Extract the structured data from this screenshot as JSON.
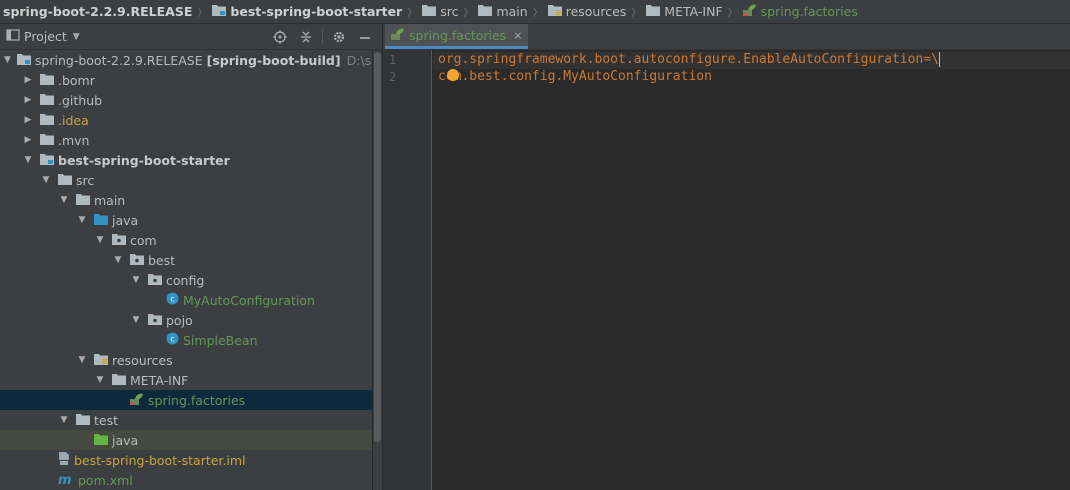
{
  "breadcrumb": [
    {
      "label": "spring-boot-2.2.9.RELEASE",
      "style": "bold",
      "icon": "module-folder-icon"
    },
    {
      "label": "best-spring-boot-starter",
      "style": "bold",
      "icon": "module-folder-icon"
    },
    {
      "label": "src",
      "style": "normal",
      "icon": "folder-icon"
    },
    {
      "label": "main",
      "style": "normal",
      "icon": "folder-icon"
    },
    {
      "label": "resources",
      "style": "normal",
      "icon": "resources-folder-icon"
    },
    {
      "label": "META-INF",
      "style": "normal",
      "icon": "folder-icon"
    },
    {
      "label": "spring.factories",
      "style": "green",
      "icon": "spring-leaf-icon"
    }
  ],
  "project_panel": {
    "title": "Project",
    "toolbar": [
      "locate-icon",
      "collapse-all-icon",
      "gear-icon",
      "hide-icon"
    ]
  },
  "tree": [
    {
      "label": "spring-boot-2.2.9.RELEASE",
      "extra_bold": "[spring-boot-build]",
      "path": "D:\\source\\",
      "arrow": "open",
      "icon": "module-folder-icon",
      "style": "normal"
    },
    {
      "label": ".bomr",
      "arrow": "closed",
      "icon": "folder-icon",
      "style": "normal"
    },
    {
      "label": ".github",
      "arrow": "closed",
      "icon": "folder-icon",
      "style": "normal"
    },
    {
      "label": ".idea",
      "arrow": "closed",
      "icon": "folder-icon",
      "style": "idea"
    },
    {
      "label": ".mvn",
      "arrow": "closed",
      "icon": "folder-icon",
      "style": "normal"
    },
    {
      "label": "best-spring-boot-starter",
      "arrow": "open",
      "icon": "module-folder-icon",
      "style": "bold"
    },
    {
      "label": "src",
      "arrow": "open",
      "icon": "folder-icon",
      "style": "normal"
    },
    {
      "label": "main",
      "arrow": "open",
      "icon": "folder-icon",
      "style": "normal"
    },
    {
      "label": "java",
      "arrow": "open",
      "icon": "source-folder-icon",
      "style": "normal"
    },
    {
      "label": "com",
      "arrow": "open",
      "icon": "package-icon",
      "style": "normal"
    },
    {
      "label": "best",
      "arrow": "open",
      "icon": "package-icon",
      "style": "normal"
    },
    {
      "label": "config",
      "arrow": "open",
      "icon": "package-icon",
      "style": "normal"
    },
    {
      "label": "MyAutoConfiguration",
      "arrow": "none",
      "icon": "class-icon",
      "style": "cls"
    },
    {
      "label": "pojo",
      "arrow": "open",
      "icon": "package-icon",
      "style": "normal"
    },
    {
      "label": "SimpleBean",
      "arrow": "none",
      "icon": "class-icon",
      "style": "cls"
    },
    {
      "label": "resources",
      "arrow": "open",
      "icon": "resources-folder-icon",
      "style": "normal"
    },
    {
      "label": "META-INF",
      "arrow": "open",
      "icon": "folder-icon",
      "style": "normal"
    },
    {
      "label": "spring.factories",
      "arrow": "none",
      "icon": "spring-leaf-icon",
      "style": "spr",
      "selected": true
    },
    {
      "label": "test",
      "arrow": "open",
      "icon": "folder-icon",
      "style": "normal"
    },
    {
      "label": "java",
      "arrow": "none",
      "icon": "test-source-folder-icon",
      "style": "normal",
      "highlight": true
    },
    {
      "label": "best-spring-boot-starter.iml",
      "arrow": "none",
      "icon": "iml-file-icon",
      "style": "iml"
    },
    {
      "label": "pom.xml",
      "arrow": "none",
      "icon": "maven-icon",
      "style": "pom"
    }
  ],
  "editor": {
    "tab_label": "spring.factories",
    "tab_close": "×",
    "line_numbers": [
      "1",
      "2"
    ],
    "lines": [
      "org.springframework.boot.autoconfigure.EnableAutoConfiguration=\\",
      "com.best.config.MyAutoConfiguration"
    ]
  },
  "colors": {
    "background": "#2b2b2b",
    "panel": "#3c3f41",
    "selection": "#0d293e",
    "spring_green": "#629755",
    "keyword_orange": "#cc7832",
    "tab_underline": "#4a88c7"
  }
}
